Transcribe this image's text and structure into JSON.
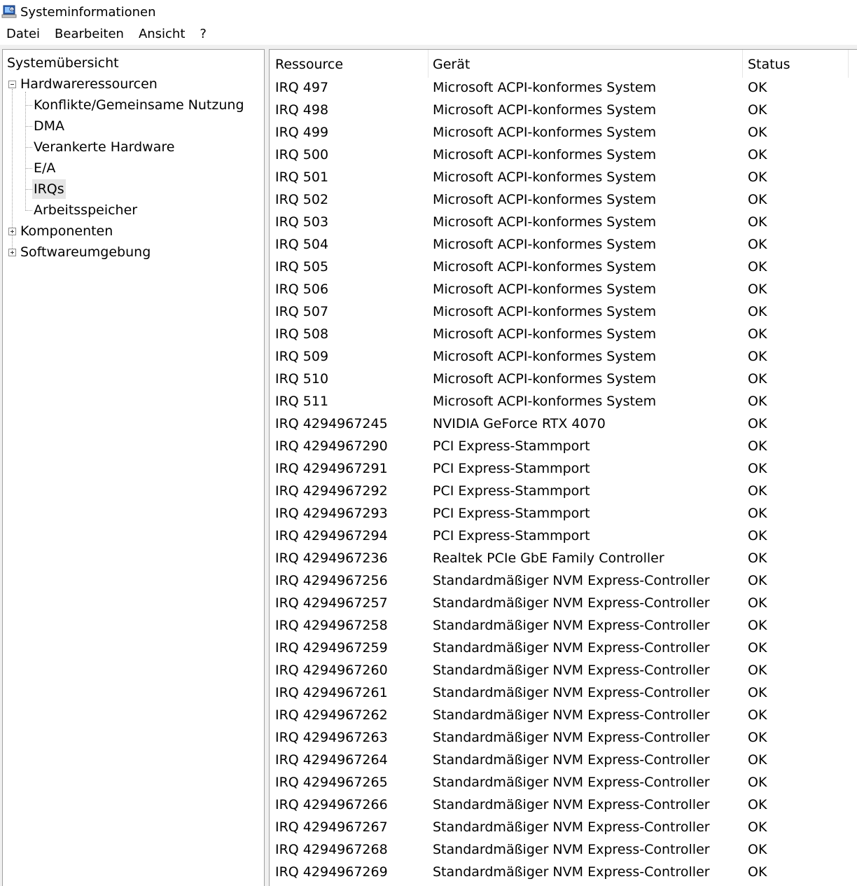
{
  "window": {
    "title": "Systeminformationen",
    "icon": "system-information-icon"
  },
  "menu": [
    "Datei",
    "Bearbeiten",
    "Ansicht",
    "?"
  ],
  "tree": {
    "root": "Systemübersicht",
    "hardware": {
      "label": "Hardwareressourcen",
      "expanded": true,
      "children": [
        "Konflikte/Gemeinsame Nutzung",
        "DMA",
        "Verankerte Hardware",
        "E/A",
        "IRQs",
        "Arbeitsspeicher"
      ],
      "selected": "IRQs"
    },
    "components": {
      "label": "Komponenten",
      "expanded": false
    },
    "software": {
      "label": "Softwareumgebung",
      "expanded": false
    }
  },
  "table": {
    "columns": [
      "Ressource",
      "Gerät",
      "Status"
    ],
    "rows": [
      [
        "IRQ 497",
        "Microsoft ACPI-konformes System",
        "OK"
      ],
      [
        "IRQ 498",
        "Microsoft ACPI-konformes System",
        "OK"
      ],
      [
        "IRQ 499",
        "Microsoft ACPI-konformes System",
        "OK"
      ],
      [
        "IRQ 500",
        "Microsoft ACPI-konformes System",
        "OK"
      ],
      [
        "IRQ 501",
        "Microsoft ACPI-konformes System",
        "OK"
      ],
      [
        "IRQ 502",
        "Microsoft ACPI-konformes System",
        "OK"
      ],
      [
        "IRQ 503",
        "Microsoft ACPI-konformes System",
        "OK"
      ],
      [
        "IRQ 504",
        "Microsoft ACPI-konformes System",
        "OK"
      ],
      [
        "IRQ 505",
        "Microsoft ACPI-konformes System",
        "OK"
      ],
      [
        "IRQ 506",
        "Microsoft ACPI-konformes System",
        "OK"
      ],
      [
        "IRQ 507",
        "Microsoft ACPI-konformes System",
        "OK"
      ],
      [
        "IRQ 508",
        "Microsoft ACPI-konformes System",
        "OK"
      ],
      [
        "IRQ 509",
        "Microsoft ACPI-konformes System",
        "OK"
      ],
      [
        "IRQ 510",
        "Microsoft ACPI-konformes System",
        "OK"
      ],
      [
        "IRQ 511",
        "Microsoft ACPI-konformes System",
        "OK"
      ],
      [
        "IRQ 4294967245",
        "NVIDIA GeForce RTX 4070",
        "OK"
      ],
      [
        "IRQ 4294967290",
        "PCI Express-Stammport",
        "OK"
      ],
      [
        "IRQ 4294967291",
        "PCI Express-Stammport",
        "OK"
      ],
      [
        "IRQ 4294967292",
        "PCI Express-Stammport",
        "OK"
      ],
      [
        "IRQ 4294967293",
        "PCI Express-Stammport",
        "OK"
      ],
      [
        "IRQ 4294967294",
        "PCI Express-Stammport",
        "OK"
      ],
      [
        "IRQ 4294967236",
        "Realtek PCIe GbE Family Controller",
        "OK"
      ],
      [
        "IRQ 4294967256",
        "Standardmäßiger NVM Express-Controller",
        "OK"
      ],
      [
        "IRQ 4294967257",
        "Standardmäßiger NVM Express-Controller",
        "OK"
      ],
      [
        "IRQ 4294967258",
        "Standardmäßiger NVM Express-Controller",
        "OK"
      ],
      [
        "IRQ 4294967259",
        "Standardmäßiger NVM Express-Controller",
        "OK"
      ],
      [
        "IRQ 4294967260",
        "Standardmäßiger NVM Express-Controller",
        "OK"
      ],
      [
        "IRQ 4294967261",
        "Standardmäßiger NVM Express-Controller",
        "OK"
      ],
      [
        "IRQ 4294967262",
        "Standardmäßiger NVM Express-Controller",
        "OK"
      ],
      [
        "IRQ 4294967263",
        "Standardmäßiger NVM Express-Controller",
        "OK"
      ],
      [
        "IRQ 4294967264",
        "Standardmäßiger NVM Express-Controller",
        "OK"
      ],
      [
        "IRQ 4294967265",
        "Standardmäßiger NVM Express-Controller",
        "OK"
      ],
      [
        "IRQ 4294967266",
        "Standardmäßiger NVM Express-Controller",
        "OK"
      ],
      [
        "IRQ 4294967267",
        "Standardmäßiger NVM Express-Controller",
        "OK"
      ],
      [
        "IRQ 4294967268",
        "Standardmäßiger NVM Express-Controller",
        "OK"
      ],
      [
        "IRQ 4294967269",
        "Standardmäßiger NVM Express-Controller",
        "OK"
      ]
    ]
  },
  "colors": {
    "window_bg": "#ffffff",
    "chrome_bg": "#f0f0f0",
    "selection": "#e6e6e6",
    "border": "#a0a0a0"
  }
}
